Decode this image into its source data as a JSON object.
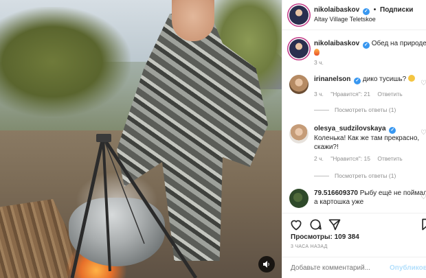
{
  "header": {
    "username": "nikolaibaskov",
    "separator": "•",
    "follow_label": "Подписки",
    "location": "Altay Village Teletskoe"
  },
  "caption": {
    "username": "nikolaibaskov",
    "text": "Обед на природе",
    "time": "3 ч."
  },
  "comments": [
    {
      "username": "irinanelson",
      "text": "дико тусишь?",
      "time": "3 ч.",
      "likes": "\"Нравится\": 21",
      "reply_label": "Ответить",
      "view_replies": "Посмотреть ответы (1)"
    },
    {
      "username": "olesya_sudzilovskaya",
      "text": "Коленька! Как же там прекрасно, скажи?!",
      "time": "2 ч.",
      "likes": "\"Нравится\": 15",
      "reply_label": "Ответить",
      "view_replies": "Посмотреть ответы (1)"
    },
    {
      "username": "79.516609370",
      "text": "Рыбу ещё не поймал, а картошка уже",
      "time": "",
      "likes": "",
      "reply_label": "",
      "view_replies": ""
    }
  ],
  "actions": {
    "likes": "Просмотры: 109 384",
    "posted": "3 ЧАСА НАЗАД"
  },
  "add_comment": {
    "placeholder": "Добавьте комментарий...",
    "post_label": "Опубликовать"
  },
  "colors": {
    "link_blue": "#3897f0",
    "post_disabled": "#b2dffc",
    "muted": "#8e8e8e"
  },
  "icons": [
    "heart-icon",
    "comment-icon",
    "share-icon",
    "bookmark-icon",
    "sound-icon",
    "verified-icon"
  ]
}
